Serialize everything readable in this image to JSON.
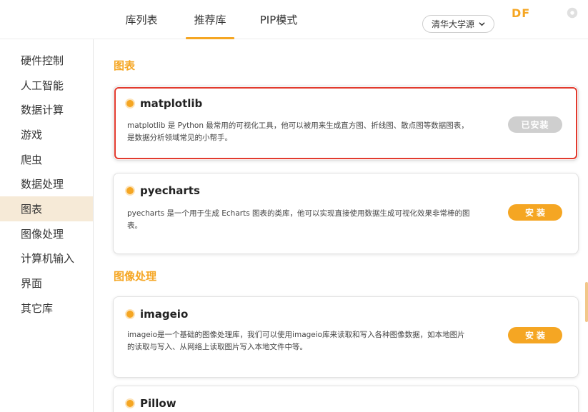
{
  "header": {
    "tabs": [
      {
        "label": "库列表",
        "active": false
      },
      {
        "label": "推荐库",
        "active": true
      },
      {
        "label": "PIP模式",
        "active": false
      }
    ],
    "source_select": "清华大学源",
    "brand": "DF"
  },
  "sidebar": {
    "items": [
      {
        "label": "硬件控制"
      },
      {
        "label": "人工智能"
      },
      {
        "label": "数据计算"
      },
      {
        "label": "游戏"
      },
      {
        "label": "爬虫"
      },
      {
        "label": "数据处理"
      },
      {
        "label": "图表",
        "active": true
      },
      {
        "label": "图像处理"
      },
      {
        "label": "计算机输入"
      },
      {
        "label": "界面"
      },
      {
        "label": "其它库"
      }
    ]
  },
  "sections": [
    {
      "title": "图表",
      "libraries": [
        {
          "name": "matplotlib",
          "desc_line1": "matplotlib 是 Python 最常用的可视化工具，他可以被用来生成直方图、折线图、散点图等数据图表，",
          "desc_line2": "是数据分析领域常见的小帮手。",
          "button": "已安装",
          "installed": true
        },
        {
          "name": "pyecharts",
          "desc_line1": "pyecharts 是一个用于生成 Echarts 图表的类库，他可以实现直接使用数据生成可视化效果非常棒的图",
          "desc_line2": "表。",
          "button": "安装",
          "installed": false
        }
      ]
    },
    {
      "title": "图像处理",
      "libraries": [
        {
          "name": "imageio",
          "desc_line1": "imageio是一个基础的图像处理库，我们可以使用imageio库来读取和写入各种图像数据，如本地图片",
          "desc_line2": "的读取与写入、从网络上读取图片写入本地文件中等。",
          "button": "安装",
          "installed": false
        },
        {
          "name": "Pillow"
        }
      ]
    }
  ],
  "colors": {
    "accent": "#f5a623",
    "installed_button": "#cfcfcf",
    "highlight_border": "#e23b2e",
    "sidebar_active_bg": "#f6ead7"
  }
}
